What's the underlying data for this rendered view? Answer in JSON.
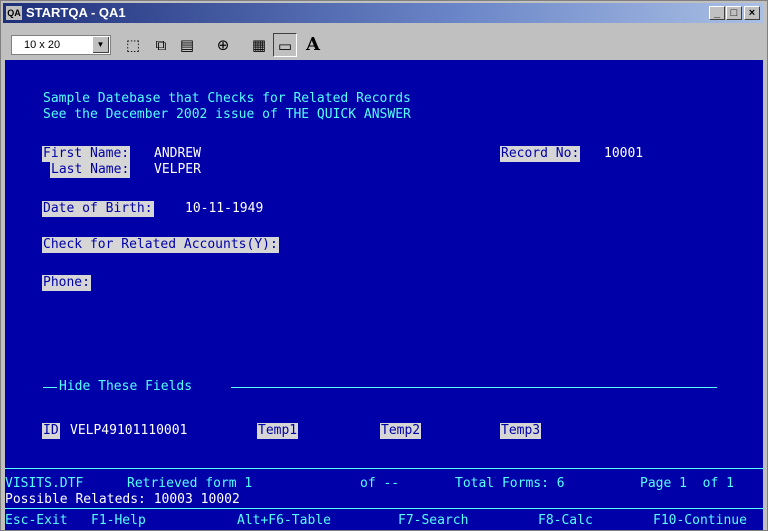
{
  "window": {
    "title": "STARTQA - QA1",
    "app_icon_text": "QA",
    "minimize": "_",
    "maximize": "□",
    "close": "×"
  },
  "toolbar": {
    "font_size_value": "10 x 20",
    "font_size_dropdown": "▼",
    "buttons": [
      "mark-icon",
      "copy-icon",
      "paste-icon",
      "fullscreen-icon",
      "properties-icon",
      "background-icon",
      "font-icon"
    ],
    "font_glyph": "A"
  },
  "form": {
    "header_line1": "Sample Datebase that Checks for Related Records",
    "header_line2": "See the December 2002 issue of THE QUICK ANSWER",
    "first_name_label": "First Name:",
    "first_name_value": "ANDREW",
    "last_name_label": "Last Name:",
    "last_name_value": "VELPER",
    "record_no_label": "Record No:",
    "record_no_value": "10001",
    "dob_label": "Date of Birth:",
    "dob_value": "10-11-1949",
    "related_label": "Check for Related Accounts(Y):",
    "related_value": "",
    "phone_label": "Phone:",
    "phone_value": "",
    "hide_section_title": "Hide These Fields",
    "id_label": "ID",
    "id_value": "VELP49101110001",
    "temp1_label": "Temp1",
    "temp2_label": "Temp2",
    "temp3_label": "Temp3"
  },
  "status": {
    "file": "VISITS.DTF",
    "retrieved": "Retrieved form 1",
    "of": "of --",
    "total": "Total Forms: 6",
    "page": "Page 1  of 1",
    "possible": "Possible Relateds: 10003 10002",
    "keys": [
      "Esc-Exit",
      "F1-Help",
      "Alt+F6-Table",
      "F7-Search",
      "F8-Calc",
      "F10-Continue"
    ]
  },
  "colors": {
    "screen_bg": "#0000a8",
    "label_bg": "#d6d6d6",
    "accent_cyan": "#55ffff"
  }
}
